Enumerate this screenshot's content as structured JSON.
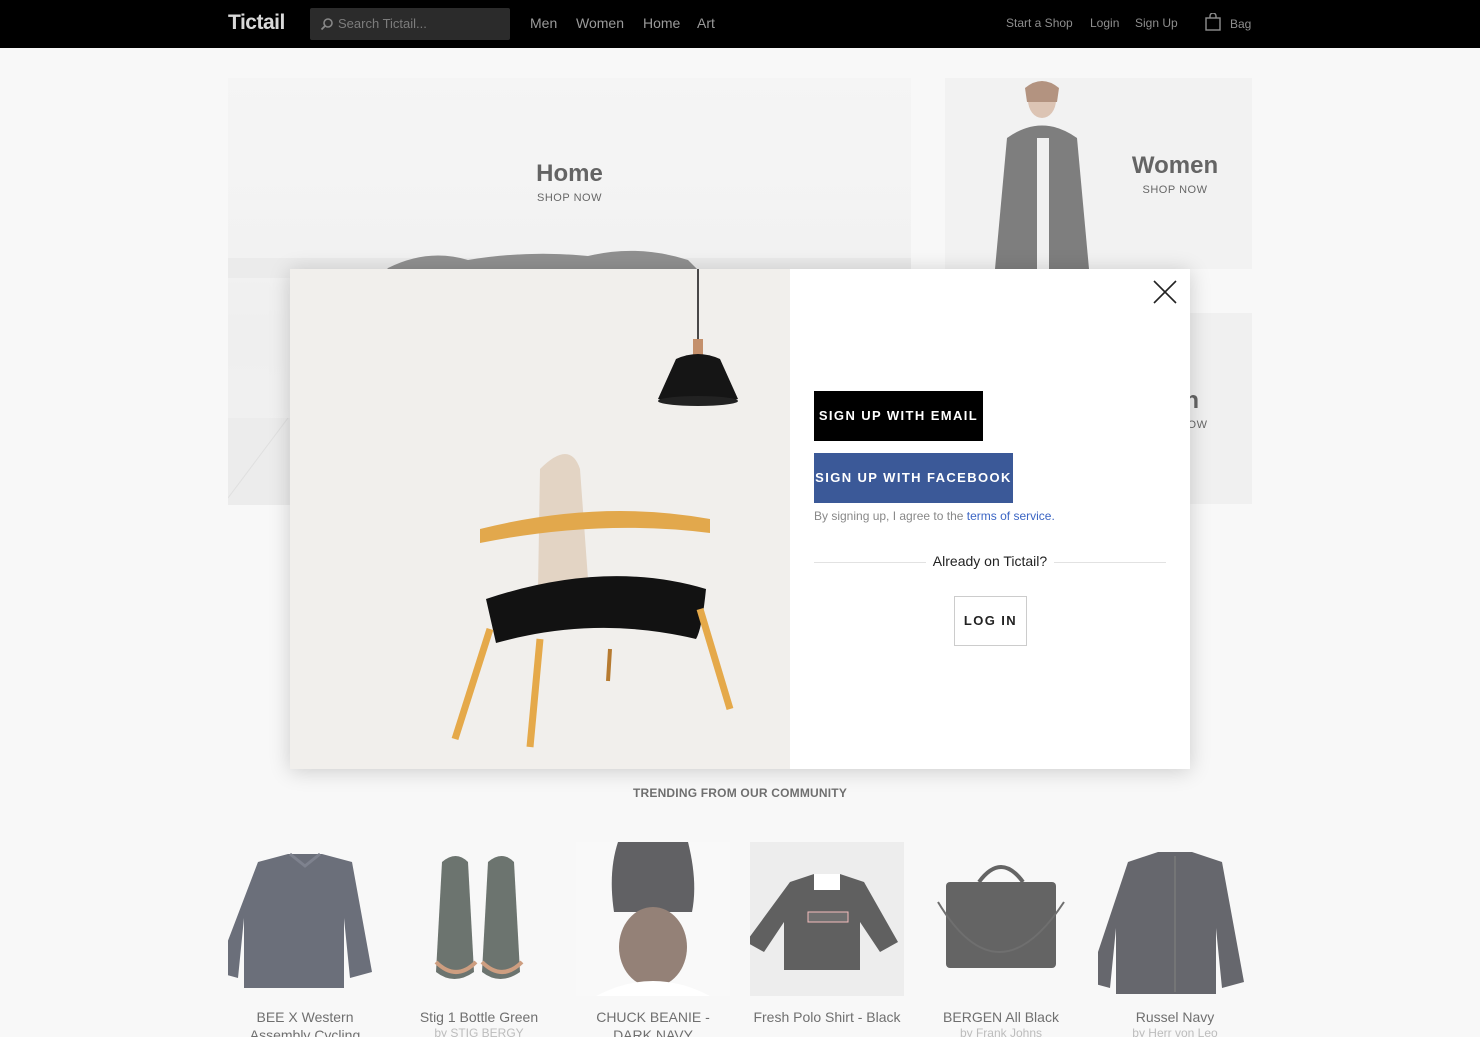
{
  "header": {
    "logo": "Tictail",
    "search_placeholder": "Search Tictail...",
    "nav": [
      "Men",
      "Women",
      "Home",
      "Art"
    ],
    "start_shop": "Start a Shop",
    "login": "Login",
    "signup": "Sign Up",
    "bag": "Bag"
  },
  "hero": {
    "home": {
      "title": "Home",
      "cta": "SHOP NOW"
    },
    "women": {
      "title": "Women",
      "cta": "SHOP NOW"
    },
    "men": {
      "title": "Men",
      "cta": "SHOP NOW"
    }
  },
  "trending": {
    "heading": "TRENDING FROM OUR COMMUNITY",
    "products": [
      {
        "name": "BEE X Western Assembly Cycling",
        "by": ""
      },
      {
        "name": "Stig 1 Bottle Green",
        "by": "by STIG BERGY"
      },
      {
        "name": "CHUCK BEANIE - DARK NAVY",
        "by": ""
      },
      {
        "name": "Fresh Polo Shirt - Black",
        "by": ""
      },
      {
        "name": "BERGEN All Black",
        "by": "by Frank Johns"
      },
      {
        "name": "Russel Navy",
        "by": "by Herr von Leo"
      }
    ]
  },
  "modal": {
    "signup_email": "SIGN UP WITH EMAIL",
    "signup_facebook": "SIGN UP WITH FACEBOOK",
    "terms_prefix": "By signing up, I agree to the",
    "terms_link": "terms of service.",
    "already": "Already on Tictail?",
    "login": "LOG IN"
  },
  "colors": {
    "facebook": "#3b5998",
    "link": "#3b65c4",
    "topbar": "#000000"
  }
}
